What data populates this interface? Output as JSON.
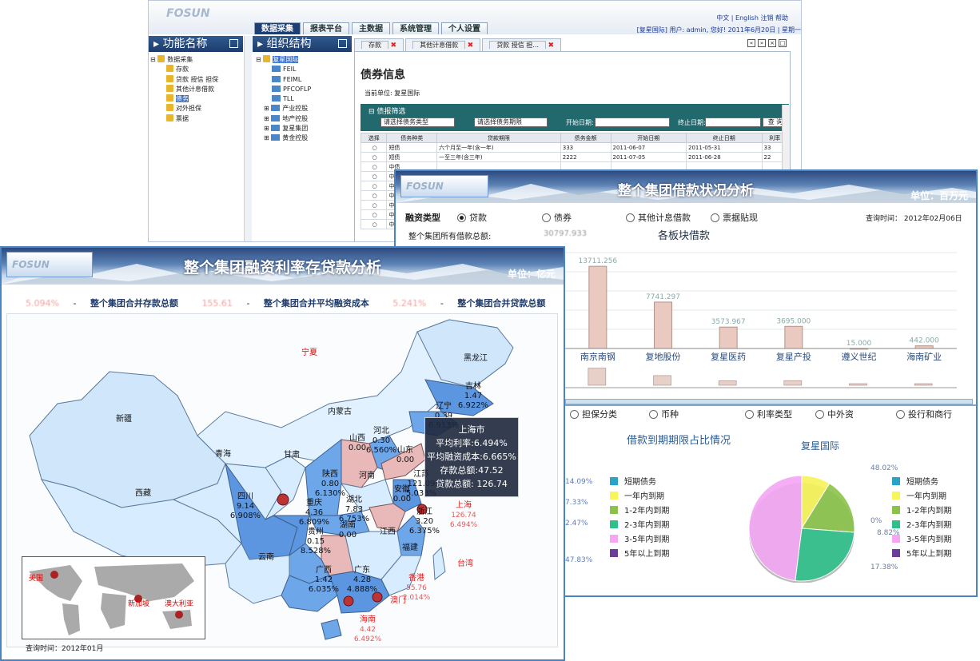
{
  "app": {
    "top_links": "中文 | English 注销 帮助",
    "user_info": "[复星国际] 用户: admin, 您好! 2011年6月20日 | 星期一",
    "menu_tabs": [
      "数据采集",
      "报表平台",
      "主数据",
      "系统管理",
      "个人设置"
    ],
    "left_panel_title": "功能名称",
    "left_tree": [
      "数据采集",
      "存款",
      "贷款 授信 担保",
      "其他计息借款",
      "债务",
      "对外担保",
      "票据"
    ],
    "org_panel_title": "组织结构",
    "org_tree": [
      "复星国际",
      "FEIL",
      "FEIML",
      "PFCOFLP",
      "TLL",
      "产业控股",
      "地产控股",
      "复星集团",
      "黄金控股"
    ],
    "doc_tabs": [
      "存款",
      "其他计息借款",
      "贷款 授信 担..."
    ],
    "page_title": "债券信息",
    "current_unit": "当前单位: 复星国际",
    "filter_title": "债报筛选",
    "bond_type_placeholder": "请选择债务类型",
    "term_placeholder": "请选择债务期限",
    "start_label": "开始日期:",
    "end_label": "终止日期:",
    "query_button": "查 询",
    "table_headers": [
      "选择",
      "债务种类",
      "贷款期限",
      "债务金额",
      "开始日期",
      "终止日期",
      "利率"
    ],
    "table_rows": [
      [
        "短债",
        "六个月至一年(含一年)",
        "333",
        "2011-06-07",
        "2011-05-31",
        "33"
      ],
      [
        "短债",
        "一至三年(含三年)",
        "2222",
        "2011-07-05",
        "2011-06-28",
        "22"
      ],
      [
        "中债",
        "",
        "",
        "",
        "",
        ""
      ],
      [
        "中债",
        "",
        "",
        "",
        "",
        ""
      ],
      [
        "中债",
        "",
        "",
        "",
        "",
        ""
      ],
      [
        "中债",
        "",
        "",
        "",
        "",
        ""
      ],
      [
        "中债",
        "",
        "",
        "",
        "",
        ""
      ],
      [
        "中债",
        "",
        "",
        "",
        "",
        ""
      ],
      [
        "中债",
        "",
        "",
        "",
        "",
        ""
      ]
    ]
  },
  "loan_panel": {
    "title": "整个集团借款状况分析",
    "unit": "单位：百万元",
    "financing_label": "融资类型",
    "financing_options": [
      "贷款",
      "债券",
      "其他计息借款",
      "票据贴现"
    ],
    "query_time": "查询时间： 2012年02月06日",
    "total_label": "整个集团所有借款总额:",
    "total_value": "30797.933",
    "sector_title": "各板块借款",
    "dimension_options": [
      "担保分类",
      "币种",
      "利率类型",
      "中外资",
      "投行和商行"
    ],
    "pie_title": "借款到期期限占比情况",
    "pie_subtitle": "复星国际",
    "left_pct_labels": [
      "14.09%",
      "7.33%",
      "2.47%",
      "47.83%"
    ],
    "legend": [
      "短期债务",
      "一年内到期",
      "1-2年内到期",
      "2-3年内到期",
      "3-5年内到期",
      "5年以上到期"
    ],
    "legend_colors": [
      "#2aa3c9",
      "#f7f557",
      "#8bc34a",
      "#2ec08a",
      "#f4a6f4",
      "#6a3d9a"
    ]
  },
  "chart_data": {
    "type": "bar",
    "title": "各板块借款",
    "categories": [
      "南京南钢",
      "复地股份",
      "复星医药",
      "复星产投",
      "遵义世纪",
      "海南矿业"
    ],
    "values": [
      13711.256,
      7741.297,
      3573.967,
      3695.0,
      15.0,
      442.0
    ],
    "value_labels": [
      "13711.256",
      "7741.297",
      "3573.967",
      "3695.000",
      "15.000",
      "442.000"
    ],
    "pie": {
      "labels": [
        "短期债务",
        "一年内到期",
        "1-2年内到期",
        "2-3年内到期",
        "3-5年内到期",
        "5年以上到期"
      ],
      "values": [
        0,
        8.82,
        17.38,
        25.78,
        48.02,
        0
      ],
      "value_labels": [
        "0%",
        "8.82%",
        "17.38%",
        "25.78%",
        "48.02%",
        "0%"
      ]
    }
  },
  "map_panel": {
    "title": "整个集团融资利率存贷款分析",
    "unit": "单位：亿元",
    "summary": [
      {
        "value": "5.094%",
        "label": "整个集团合并存款总额"
      },
      {
        "value": "155.61",
        "label": "整个集团合并平均融资成本"
      },
      {
        "value": "5.241%",
        "label": "整个集团合并贷款总额"
      }
    ],
    "query_time": "查询时间：2012年01月",
    "tooltip": {
      "title": "上海市",
      "lines": [
        "平均利率:6.494%",
        "平均融资成本:6.665%",
        "存款总额:47.52",
        "贷款总额: 126.74"
      ]
    },
    "regions": [
      {
        "name": "黑龙江",
        "detail": ""
      },
      {
        "name": "吉林",
        "detail": "1.47 6.922%"
      },
      {
        "name": "辽宁",
        "detail": "0.39 6.913%"
      },
      {
        "name": "内蒙古",
        "detail": ""
      },
      {
        "name": "新疆",
        "detail": ""
      },
      {
        "name": "西藏",
        "detail": ""
      },
      {
        "name": "青海",
        "detail": ""
      },
      {
        "name": "甘肃",
        "detail": ""
      },
      {
        "name": "宁夏",
        "detail": ""
      },
      {
        "name": "山西",
        "detail": "0.00"
      },
      {
        "name": "河北",
        "detail": "0.30 6.560%"
      },
      {
        "name": "山东",
        "detail": "0.00"
      },
      {
        "name": "河南",
        "detail": ""
      },
      {
        "name": "陕西",
        "detail": "0.80 6.130%"
      },
      {
        "name": "江苏",
        "detail": "121.09 5.033%"
      },
      {
        "name": "安徽",
        "detail": "0.00"
      },
      {
        "name": "四川",
        "detail": "9.14 6.908%"
      },
      {
        "name": "重庆",
        "detail": "4.36 6.809%"
      },
      {
        "name": "湖北",
        "detail": "7.83 6.753%"
      },
      {
        "name": "浙江",
        "detail": "3.20 6.375%"
      },
      {
        "name": "湖南",
        "detail": "0.00"
      },
      {
        "name": "贵州",
        "detail": "0.15 8.528%"
      },
      {
        "name": "江西",
        "detail": ""
      },
      {
        "name": "福建",
        "detail": ""
      },
      {
        "name": "云南",
        "detail": ""
      },
      {
        "name": "广西",
        "detail": "1.42 6.035%"
      },
      {
        "name": "广东",
        "detail": "4.28 4.888%"
      }
    ],
    "red_labels": [
      {
        "name": "上海",
        "detail": "126.74 6.494%"
      },
      {
        "name": "香港",
        "detail": "55.76 2.014%"
      },
      {
        "name": "澳门",
        "detail": ""
      },
      {
        "name": "台湾",
        "detail": ""
      },
      {
        "name": "海南",
        "detail": "4.42 6.492%"
      }
    ],
    "world": [
      "美国",
      "新加坡",
      "澳大利亚"
    ]
  }
}
